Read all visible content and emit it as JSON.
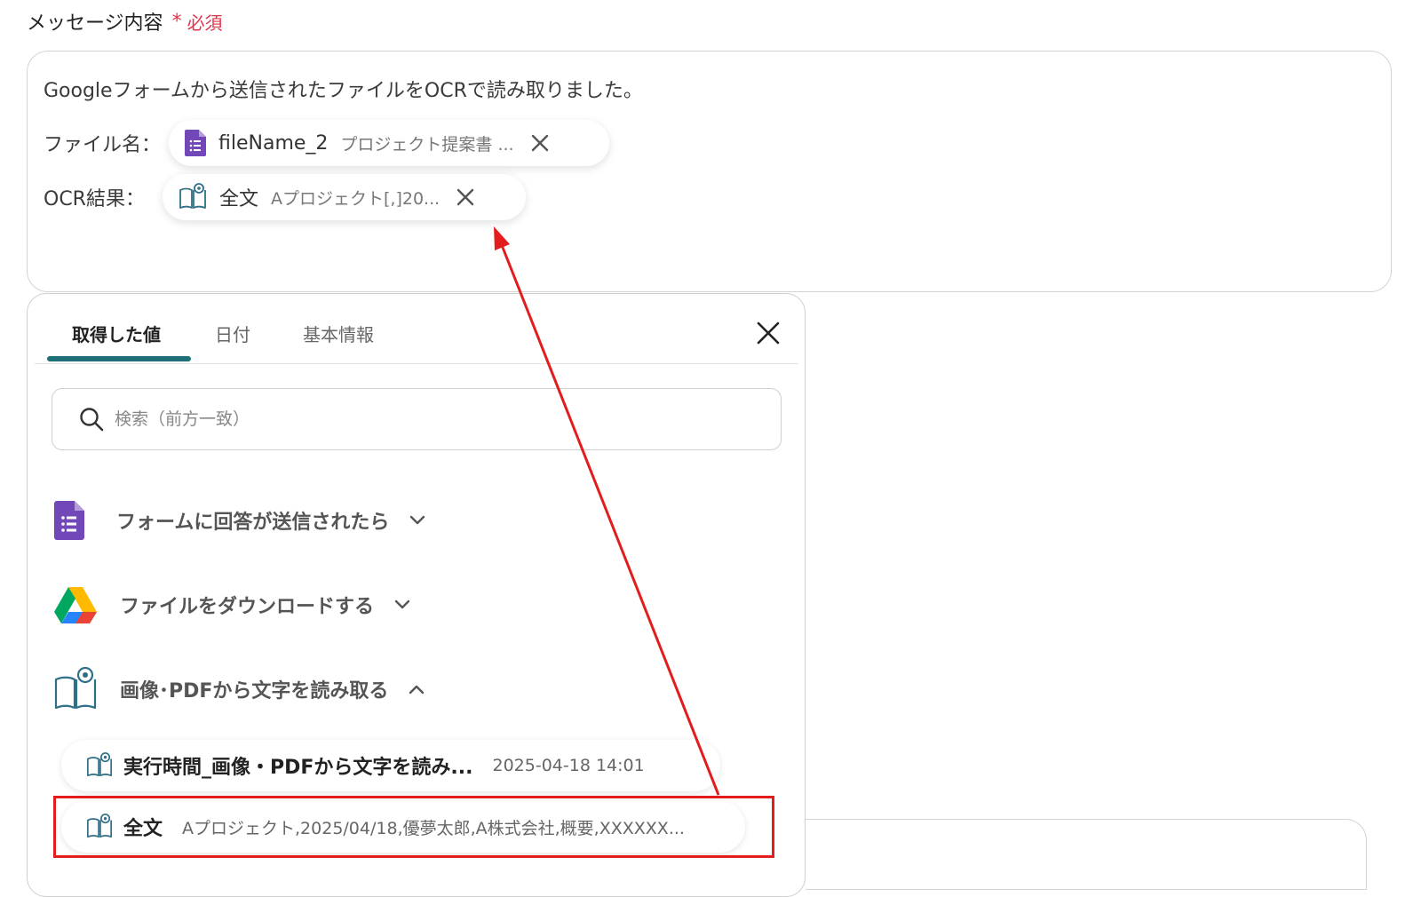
{
  "field": {
    "label": "メッセージ内容",
    "required_star": "*",
    "required_text": "必須"
  },
  "message": {
    "line1": "Googleフォームから送信されたファイルをOCRで読み取りました。",
    "file_label": "ファイル名：",
    "ocr_label": "OCR結果："
  },
  "chips": {
    "file": {
      "main": "fileName_2",
      "sub": "プロジェクト提案書 ..."
    },
    "ocr": {
      "main": "全文",
      "sub": "Aプロジェクト[,]20..."
    }
  },
  "panel": {
    "tabs": [
      "取得した値",
      "日付",
      "基本情報"
    ],
    "active_tab": 0,
    "search_placeholder": "検索（前方一致）",
    "groups": [
      {
        "label": "フォームに回答が送信されたら",
        "icon": "google-forms-icon",
        "expanded": false
      },
      {
        "label": "ファイルをダウンロードする",
        "icon": "google-drive-icon",
        "expanded": false
      },
      {
        "label": "画像･PDFから文字を読み取る",
        "icon": "ocr-book-icon",
        "expanded": true
      }
    ],
    "items": [
      {
        "title": "実行時間_画像・PDFから文字を読み...",
        "value": "2025-04-18 14:01"
      },
      {
        "title": "全文",
        "value": "Aプロジェクト,2025/04/18,優夢太郎,A株式会社,概要,XXXXXX..."
      }
    ]
  },
  "colors": {
    "accent": "#1f6f7a",
    "required": "#e0344b",
    "annotation": "#e31d1d",
    "forms_purple": "#7248b9"
  }
}
